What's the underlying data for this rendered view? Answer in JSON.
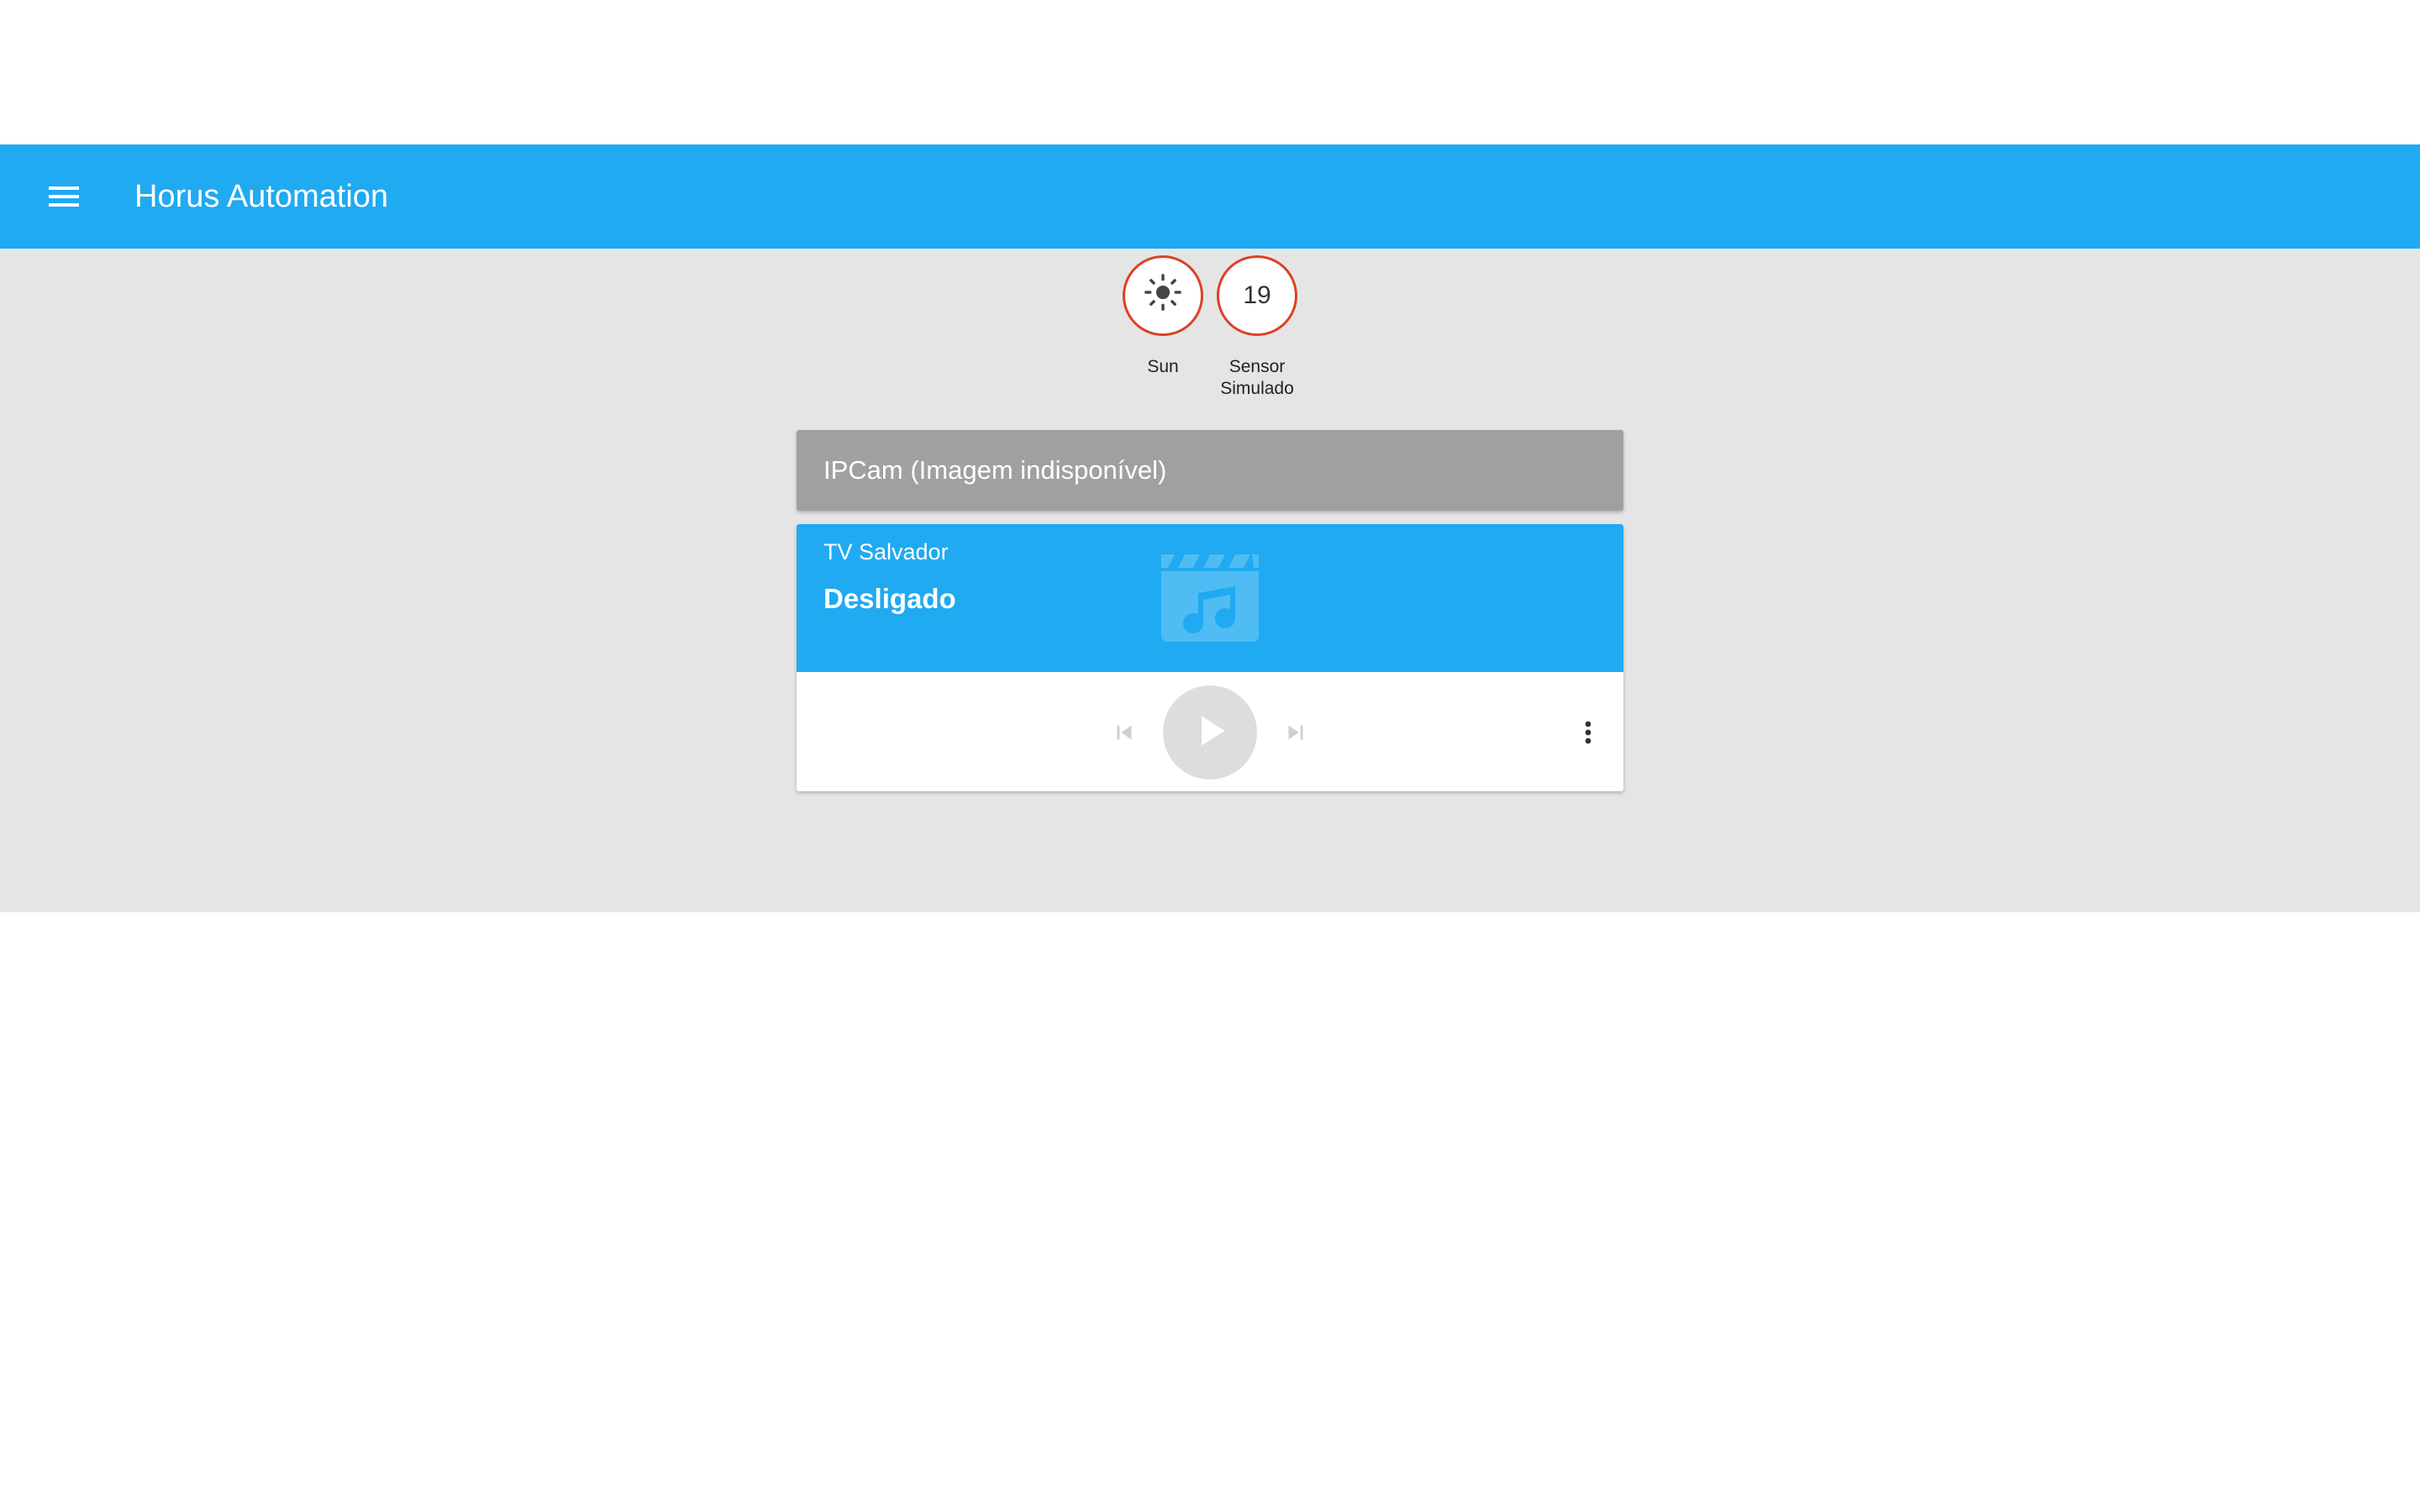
{
  "app": {
    "title": "Horus Automation",
    "menu_icon": "menu-icon"
  },
  "badges": [
    {
      "label": "Sun",
      "icon": "sun-icon",
      "value": ""
    },
    {
      "label": "Sensor Simulado",
      "value": "19"
    }
  ],
  "cards": {
    "camera": {
      "title": "IPCam (Imagem indisponível)"
    },
    "media": {
      "name": "TV Salvador",
      "state": "Desligado",
      "art_icon": "movie-music-icon",
      "controls": [
        "skip-previous-icon",
        "play-icon",
        "skip-next-icon",
        "more-vert-icon"
      ]
    }
  },
  "colors": {
    "primary": "#1faaf1",
    "badge_border": "#db4125",
    "background": "#e5e5e6",
    "camera_card": "#a0a0a0"
  }
}
